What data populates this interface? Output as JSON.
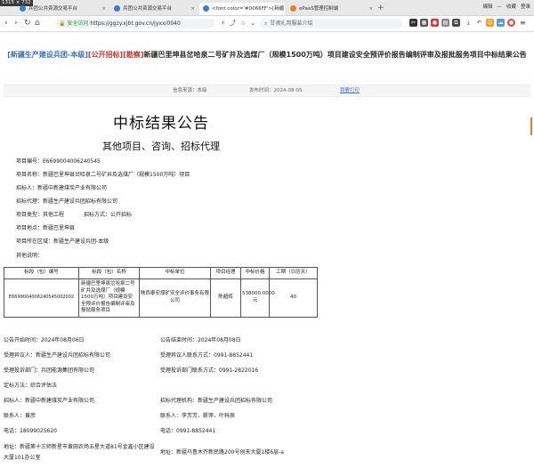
{
  "browser": {
    "size_badge": "1315 × 732",
    "tabs": [
      {
        "label": "兵团公共资源交易平台",
        "active": false
      },
      {
        "label": "兵团公共资源交易平台",
        "active": false
      },
      {
        "label": "<font color='#0066FF'>[新疆",
        "active": true
      },
      {
        "label": "ePaaS管理控制端",
        "active": false
      }
    ],
    "window_controls": [
      "编辑",
      "收藏",
      "登录"
    ],
    "address": {
      "security_label": "安全访问",
      "url": "https://ggzy.xjbt.gov.cn/jyxx/0040"
    },
    "search_placeholder": "甘肃扎邦服装介绍"
  },
  "article": {
    "headline_tag1": "[新疆生产建设兵团-本级]",
    "headline_tag2": "[公开招标]",
    "headline_tag3": "[勘察]",
    "headline_text": "新疆巴里坤县岔哈泉二号矿井及选煤厂（规模1500万吨）项目建设安全预评价报告编制评审及报批服务项目中标结果公告",
    "meta_source": "信息来源：本级",
    "meta_date": "发布时间：2024-08-05",
    "meta_print": "我要打印",
    "title": "中标结果公告",
    "subtitle": "其他项目、咨询、招标代理",
    "fields": {
      "project_no": "项目编号：E6699004006240545",
      "project_name": "项目名称：新疆巴里坤县岔哈泉二号矿井及选煤厂（规模1500万吨）项目",
      "tenderer": "招标人：新疆中新建煤炭产业有限公司",
      "agent": "招标代理：新疆生产建设兵团招标有限公司",
      "project_type": "项目类型：其他工程",
      "tender_method": "招标方式：公开招标",
      "location": "项目地点：新疆巴里坤县",
      "region": "项目所在区域：新疆生产建设兵团-本级",
      "remarks": "其他说明："
    },
    "table": {
      "headers": [
        "标段（包）编号",
        "标段（包）名称",
        "中标单位",
        "项目经理",
        "中标价格",
        "工期（日历天）"
      ],
      "rows": [
        {
          "code": "E6699004006240545002002",
          "name": "新疆巴里坤县岔哈泉二号矿井及选煤厂（规模1500万吨）项目建设安全预评价报告编制评审及报批服务项目",
          "winner": "陕西泰安煤矿安全评价事务有限公司",
          "manager": "陈超辉",
          "price": "538000.0000元",
          "duration": "40"
        }
      ]
    },
    "footer": {
      "announce_start": "公告开始时间：2024年08月06日",
      "announce_end": "公告结束时间：2024年08月08日",
      "objection_person": "受理异议人：新疆生产建设兵团招标有限公司",
      "objection_contact": "受理异议人联系方式：0991-8852441",
      "complaint_dept": "受理投诉部门：兵团能源集团有限公司",
      "complaint_contact": "受理投诉部门联系方式：0991-2822016",
      "bid_method": "定标方法：综合评估法",
      "tenderer": "招标人：新疆中新建煤炭产业有限公司",
      "agent": "招标代理机构：新疆生产建设兵团招标有限公司",
      "contact_person": "联系人：黄彦",
      "agent_contact_person": "联系人：李芳芳、靳萍、叶科辰",
      "phone": "电话：18099025620",
      "agent_phone": "电话：0991-8852441",
      "address": "地址：新疆第十三师新星市黄田农场五星大道81号金鑫小区建设大厦101办公室",
      "agent_address": "地址：新疆乌鲁木齐新民路200号创天大厦1楼6层-a"
    }
  }
}
